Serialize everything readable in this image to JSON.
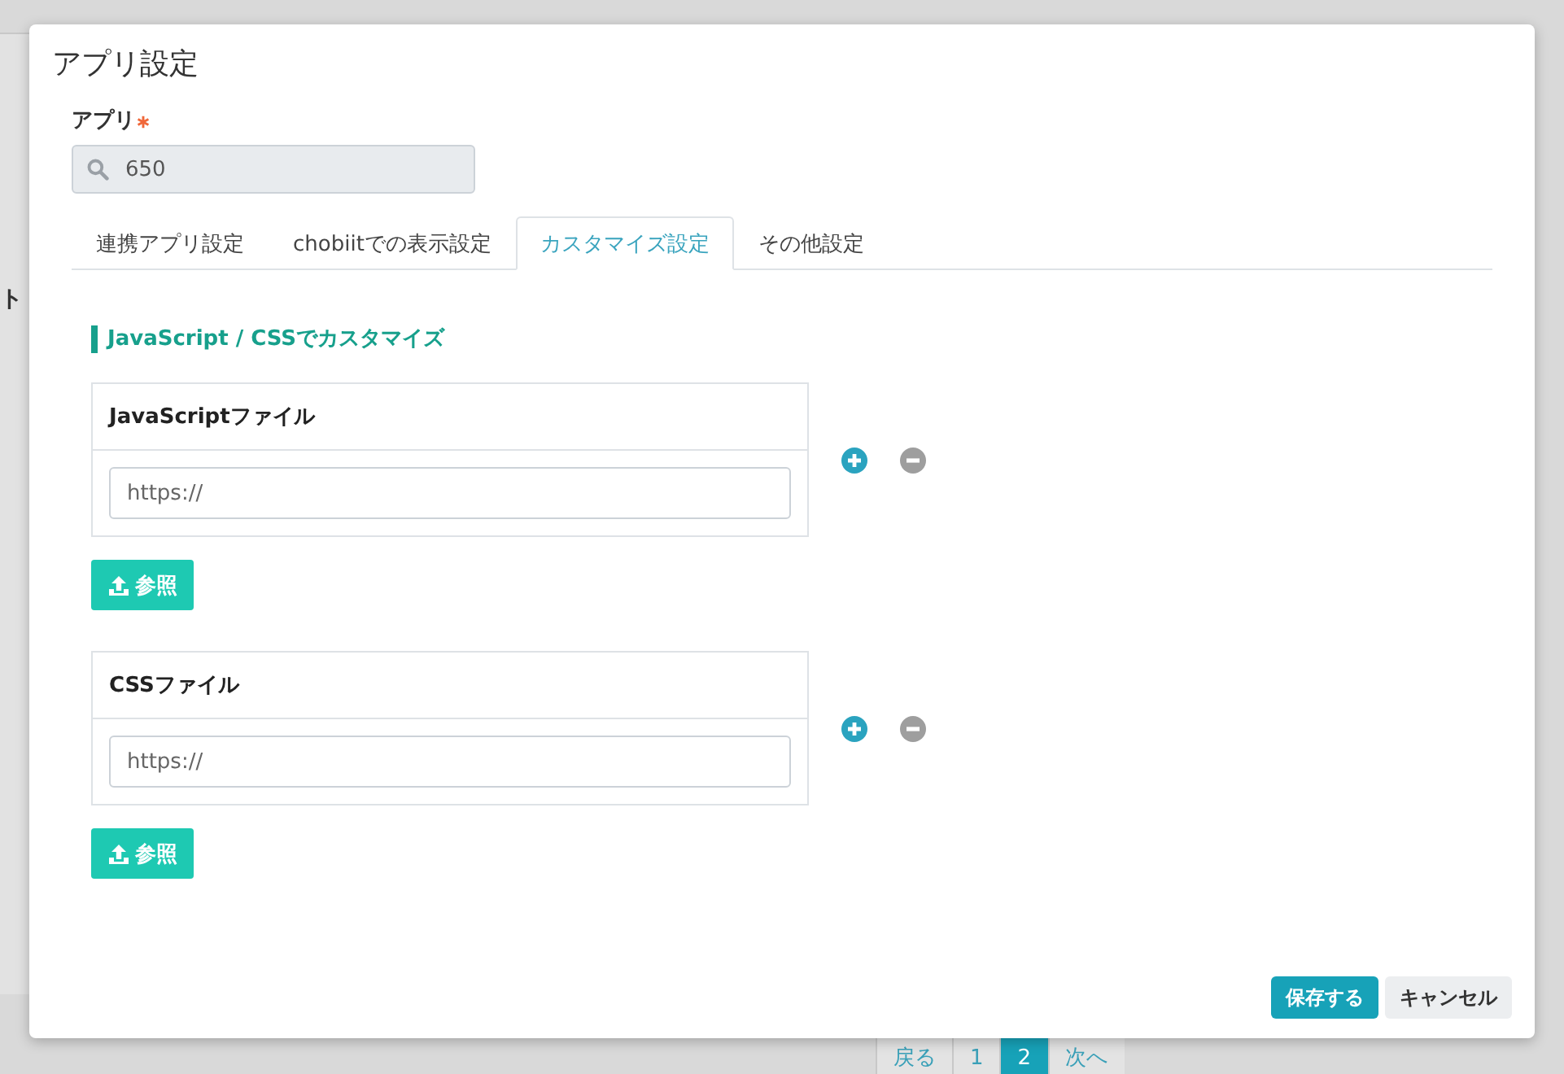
{
  "background": {
    "column_fragment": "ト",
    "pagination": [
      {
        "label": "戻る",
        "selected": false
      },
      {
        "label": "1",
        "selected": false
      },
      {
        "label": "2",
        "selected": true
      },
      {
        "label": "次へ",
        "selected": false
      }
    ]
  },
  "dialog": {
    "title": "アプリ設定",
    "app_field": {
      "label": "アプリ",
      "required": true,
      "value": "650"
    },
    "tabs": [
      {
        "label": "連携アプリ設定",
        "selected": false
      },
      {
        "label": "chobiitでの表示設定",
        "selected": false
      },
      {
        "label": "カスタマイズ設定",
        "selected": true
      },
      {
        "label": "その他設定",
        "selected": false
      }
    ],
    "section_title": "JavaScript / CSSでカスタマイズ",
    "file_groups": [
      {
        "heading": "JavaScriptファイル",
        "placeholder": "https://",
        "browse_button": "参照"
      },
      {
        "heading": "CSSファイル",
        "placeholder": "https://",
        "browse_button": "参照"
      }
    ],
    "buttons": [
      {
        "label": "保存する",
        "kind": "primary"
      },
      {
        "label": "キャンセル",
        "kind": "secondary"
      }
    ]
  }
}
